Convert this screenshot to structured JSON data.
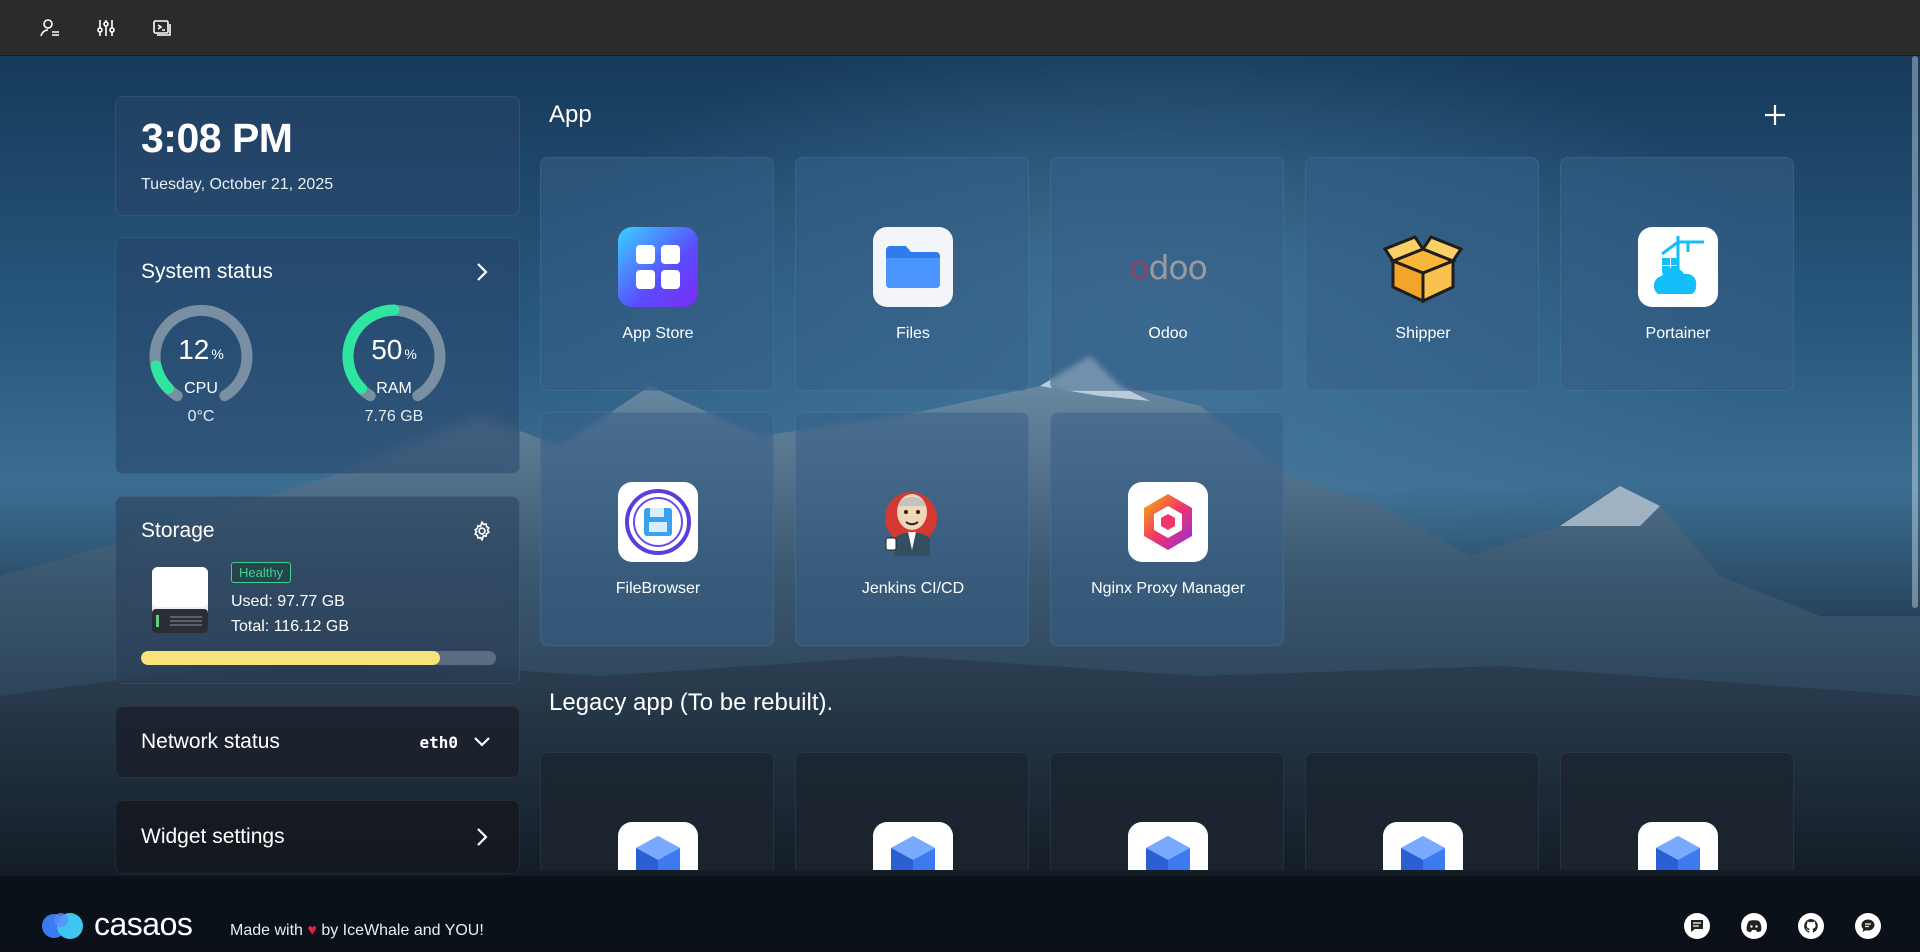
{
  "topbar": {
    "icons": [
      "user-icon",
      "sliders-icon",
      "terminal-icon"
    ]
  },
  "clock": {
    "time": "3:08 PM",
    "date": "Tuesday, October 21, 2025"
  },
  "system_status": {
    "title": "System status",
    "cpu": {
      "value": "12",
      "unit": "%",
      "label": "CPU",
      "sub": "0°C",
      "percent": 12
    },
    "ram": {
      "value": "50",
      "unit": "%",
      "label": "RAM",
      "sub": "7.76 GB",
      "percent": 50
    },
    "accent": "#2ee6a0"
  },
  "storage": {
    "title": "Storage",
    "status": "Healthy",
    "used": "Used: 97.77 GB",
    "total": "Total: 116.12 GB",
    "fill_fraction": 0.842,
    "bar_color": "#f7e27c"
  },
  "network": {
    "title": "Network status",
    "interface": "eth0"
  },
  "widget_settings": {
    "title": "Widget settings"
  },
  "apps": {
    "title": "App",
    "items": [
      {
        "name": "App Store",
        "icon": "app-store-icon"
      },
      {
        "name": "Files",
        "icon": "folder-icon"
      },
      {
        "name": "Odoo",
        "icon": "odoo-icon",
        "logo_text": "odoo"
      },
      {
        "name": "Shipper",
        "icon": "shipper-box-icon"
      },
      {
        "name": "Portainer",
        "icon": "portainer-icon"
      },
      {
        "name": "FileBrowser",
        "icon": "filebrowser-icon"
      },
      {
        "name": "Jenkins CI/CD",
        "icon": "jenkins-icon"
      },
      {
        "name": "Nginx Proxy Manager",
        "icon": "nginx-proxy-manager-icon"
      }
    ]
  },
  "legacy": {
    "title": "Legacy app (To be rebuilt).",
    "count_visible": 5,
    "icon": "cube-icon"
  },
  "footer": {
    "brand": "casaos",
    "made_prefix": "Made with",
    "heart": "♥",
    "made_suffix": "by IceWhale and YOU!",
    "icons": [
      "chat-icon",
      "discord-icon",
      "github-icon",
      "message-icon"
    ]
  }
}
